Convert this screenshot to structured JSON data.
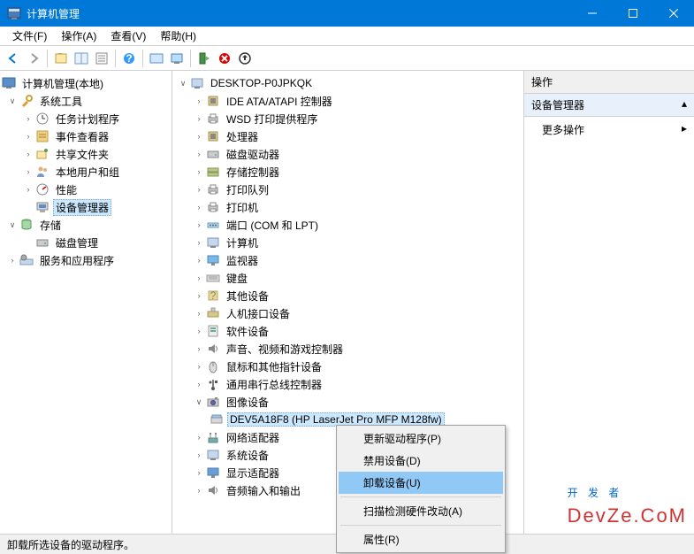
{
  "window": {
    "title": "计算机管理"
  },
  "menu": {
    "file": "文件(F)",
    "action": "操作(A)",
    "view": "查看(V)",
    "help": "帮助(H)"
  },
  "leftTree": {
    "root": "计算机管理(本地)",
    "systemTools": "系统工具",
    "taskScheduler": "任务计划程序",
    "eventViewer": "事件查看器",
    "sharedFolders": "共享文件夹",
    "localUsers": "本地用户和组",
    "performance": "性能",
    "deviceManager": "设备管理器",
    "storage": "存储",
    "diskManagement": "磁盘管理",
    "servicesApps": "服务和应用程序"
  },
  "devTree": {
    "root": "DESKTOP-P0JPKQK",
    "ideAta": "IDE ATA/ATAPI 控制器",
    "wsd": "WSD 打印提供程序",
    "cpu": "处理器",
    "diskDrive": "磁盘驱动器",
    "storageCtl": "存储控制器",
    "printQueue": "打印队列",
    "printer": "打印机",
    "ports": "端口 (COM 和 LPT)",
    "computer": "计算机",
    "monitor": "监视器",
    "keyboard": "键盘",
    "otherDev": "其他设备",
    "hid": "人机接口设备",
    "software": "软件设备",
    "audio": "声音、视频和游戏控制器",
    "mouse": "鼠标和其他指针设备",
    "usb": "通用串行总线控制器",
    "imaging": "图像设备",
    "imagingChild": "DEV5A18F8 (HP LaserJet Pro MFP M128fw)",
    "network": "网络适配器",
    "system": "系统设备",
    "display": "显示适配器",
    "audioIO": "音频输入和输出"
  },
  "actions": {
    "header": "操作",
    "sub": "设备管理器",
    "more": "更多操作"
  },
  "context": {
    "update": "更新驱动程序(P)",
    "disable": "禁用设备(D)",
    "uninstall": "卸载设备(U)",
    "scan": "扫描检测硬件改动(A)",
    "props": "属性(R)"
  },
  "status": "卸载所选设备的驱动程序。",
  "watermark": {
    "line1": "开 发 者",
    "line2": "DevZe.CoM"
  }
}
